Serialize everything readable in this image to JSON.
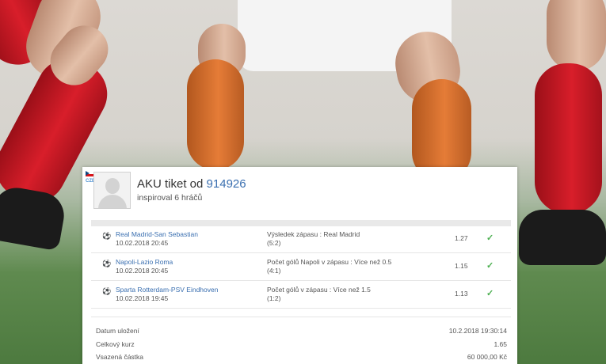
{
  "ticket": {
    "title_prefix": "AKU tiket od",
    "ticket_number": "914926",
    "inspired_prefix": "inspiroval",
    "inspired_count": "6",
    "inspired_suffix": "hráčů",
    "country_tag": "CZE"
  },
  "bets": [
    {
      "match": "Real Madrid-San Sebastian",
      "datetime": "10.02.2018 20:45",
      "bet": "Výsledek zápasu : Real Madrid",
      "score": "(5:2)",
      "odds": "1.27",
      "status_icon": "check-icon"
    },
    {
      "match": "Napoli-Lazio Roma",
      "datetime": "10.02.2018 20:45",
      "bet": "Počet gólů Napoli v zápasu : Více než 0.5",
      "score": "(4:1)",
      "odds": "1.15",
      "status_icon": "check-icon"
    },
    {
      "match": "Sparta Rotterdam-PSV Eindhoven",
      "datetime": "10.02.2018 19:45",
      "bet": "Počet gólů v zápasu : Více než 1.5",
      "score": "(1:2)",
      "odds": "1.13",
      "status_icon": "check-icon"
    }
  ],
  "summary": {
    "saved_label": "Datum uložení",
    "saved_value": "10.2.2018 19:30:14",
    "total_odds_label": "Celkový kurz",
    "total_odds_value": "1.65",
    "stake_label": "Vsazená částka",
    "stake_value": "60 000,00 Kč"
  },
  "colors": {
    "link": "#3a6fb0",
    "win": "#4caf50"
  }
}
